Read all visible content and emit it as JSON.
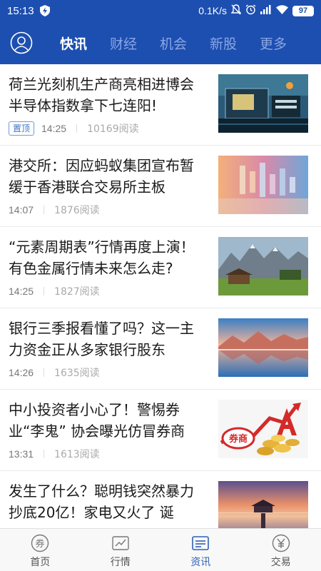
{
  "status_bar": {
    "time": "15:13",
    "network_speed": "0.1K/s",
    "battery": "97"
  },
  "header": {
    "tabs": [
      {
        "label": "快讯",
        "active": true
      },
      {
        "label": "财经",
        "active": false
      },
      {
        "label": "机会",
        "active": false
      },
      {
        "label": "新股",
        "active": false
      },
      {
        "label": "更多",
        "active": false
      }
    ]
  },
  "feed": {
    "items": [
      {
        "title": "荷兰光刻机生产商亮相进博会 半导体指数拿下七连阳!",
        "tag": "置顶",
        "time": "14:25",
        "reads": "10169阅读",
        "thumb": "circuit-board-image"
      },
      {
        "title": "港交所：因应蚂蚁集团宣布暂缓于香港联合交易所主板",
        "time": "14:07",
        "reads": "1876阅读",
        "thumb": "stock-chart-image"
      },
      {
        "title": "“元素周期表”行情再度上演！有色金属行情未来怎么走?",
        "time": "14:25",
        "reads": "1827阅读",
        "thumb": "mountain-cabin-image"
      },
      {
        "title": "银行三季报看懂了吗？这一主力资金正从多家银行股东",
        "time": "14:26",
        "reads": "1635阅读",
        "thumb": "mountain-lake-image"
      },
      {
        "title": "中小投资者小心了！警惕券业“李鬼” 协会曝光仿冒券商",
        "time": "13:31",
        "reads": "1613阅读",
        "thumb": "broker-coins-image",
        "thumb_text": "券商"
      },
      {
        "title": "发生了什么？聪明钱突然暴力抄底20亿！家电又火了 诞",
        "time": "",
        "reads": "",
        "thumb": "sunset-pier-image"
      }
    ]
  },
  "bottom_nav": {
    "items": [
      {
        "label": "首页",
        "icon": "home-coupon-icon",
        "active": false
      },
      {
        "label": "行情",
        "icon": "market-chart-icon",
        "active": false
      },
      {
        "label": "资讯",
        "icon": "news-icon",
        "active": true
      },
      {
        "label": "交易",
        "icon": "trade-yen-icon",
        "active": false
      }
    ]
  },
  "colors": {
    "brand_blue": "#1d4fb0",
    "tab_inactive": "#8aa6e3",
    "nav_active": "#2f61b8"
  }
}
